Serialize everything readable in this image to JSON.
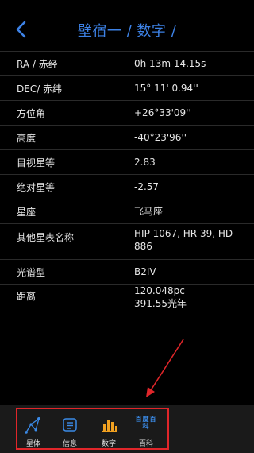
{
  "header": {
    "title": "壁宿一 / 数字 /"
  },
  "rows": [
    {
      "label": "RA / 赤经",
      "value": "0h 13m 14.15s"
    },
    {
      "label": "DEC/ 赤纬",
      "value": "15° 11' 0.94''"
    },
    {
      "label": "方位角",
      "value": "+26°33'09''"
    },
    {
      "label": "高度",
      "value": "-40°23'96''"
    },
    {
      "label": "目视星等",
      "value": "2.83"
    },
    {
      "label": "绝对星等",
      "value": "-2.57"
    },
    {
      "label": "星座",
      "value": "飞马座"
    },
    {
      "label": "其他星表名称",
      "value": "HIP 1067, HR 39, HD 886"
    },
    {
      "label": "光谱型",
      "value": "B2IV"
    },
    {
      "label": "距离",
      "value_line1": "120.048pc",
      "value_line2": "391.55光年"
    }
  ],
  "tabbar": {
    "tabs": [
      {
        "label": "星体",
        "icon": "constellation-icon"
      },
      {
        "label": "信息",
        "icon": "info-card-icon"
      },
      {
        "label": "数字",
        "icon": "bar-chart-icon"
      },
      {
        "label": "百科",
        "icon": "baike-logo-icon",
        "icon_text": "百度百科"
      }
    ]
  },
  "colors": {
    "background": "#000000",
    "accent": "#3d82e6",
    "tab_icon": "#3b8be8",
    "tab_icon_active": "#f0a020",
    "annotation_red": "#e0262a",
    "tabbar_bg": "#1a1a1a"
  }
}
